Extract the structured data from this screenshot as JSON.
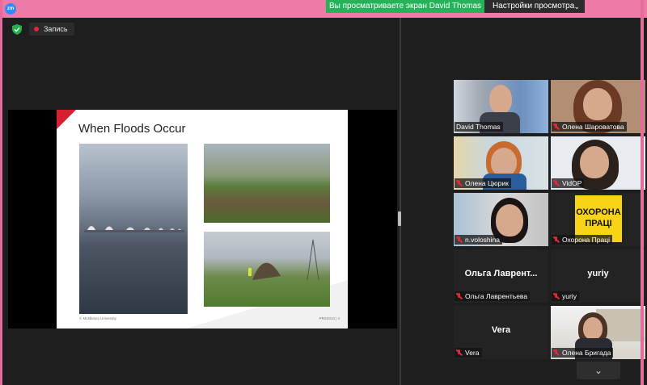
{
  "app": {
    "logo_text": "zm"
  },
  "topbar": {
    "share_notice": "Вы просматриваете экран David Thomas",
    "view_options": "Настройки просмотра"
  },
  "recording": {
    "label": "Запись"
  },
  "slide": {
    "title": "When Floods Occur",
    "footer": "© Middlesex University",
    "page": "PRS3313 | 4"
  },
  "gallery": {
    "tiles": [
      {
        "name": "David Thomas",
        "muted": false,
        "video": true
      },
      {
        "name": "Олена Шароватова",
        "muted": true,
        "video": true
      },
      {
        "name": "Олена Цюрик",
        "muted": true,
        "video": true
      },
      {
        "name": "VidOP",
        "muted": true,
        "video": true
      },
      {
        "name": "n.voloshina",
        "muted": true,
        "video": true
      },
      {
        "name": "Охорона Праці",
        "muted": true,
        "video": true,
        "logo_line1": "ОХОРОНА",
        "logo_line2": "ПРАЦІ"
      },
      {
        "name": "Ольга Лаврентьева",
        "muted": true,
        "video": false,
        "display": "Ольга Лаврент..."
      },
      {
        "name": "yuriy",
        "muted": true,
        "video": false,
        "display": "yuriy"
      },
      {
        "name": "Vera",
        "muted": true,
        "video": false,
        "display": "Vera"
      },
      {
        "name": "Олена Бригада",
        "muted": true,
        "video": true
      }
    ]
  },
  "colors": {
    "frame": "#e46d9e",
    "share_green": "#25b35a",
    "active_speaker": "#c2dd4f",
    "muted": "#e0283a"
  }
}
